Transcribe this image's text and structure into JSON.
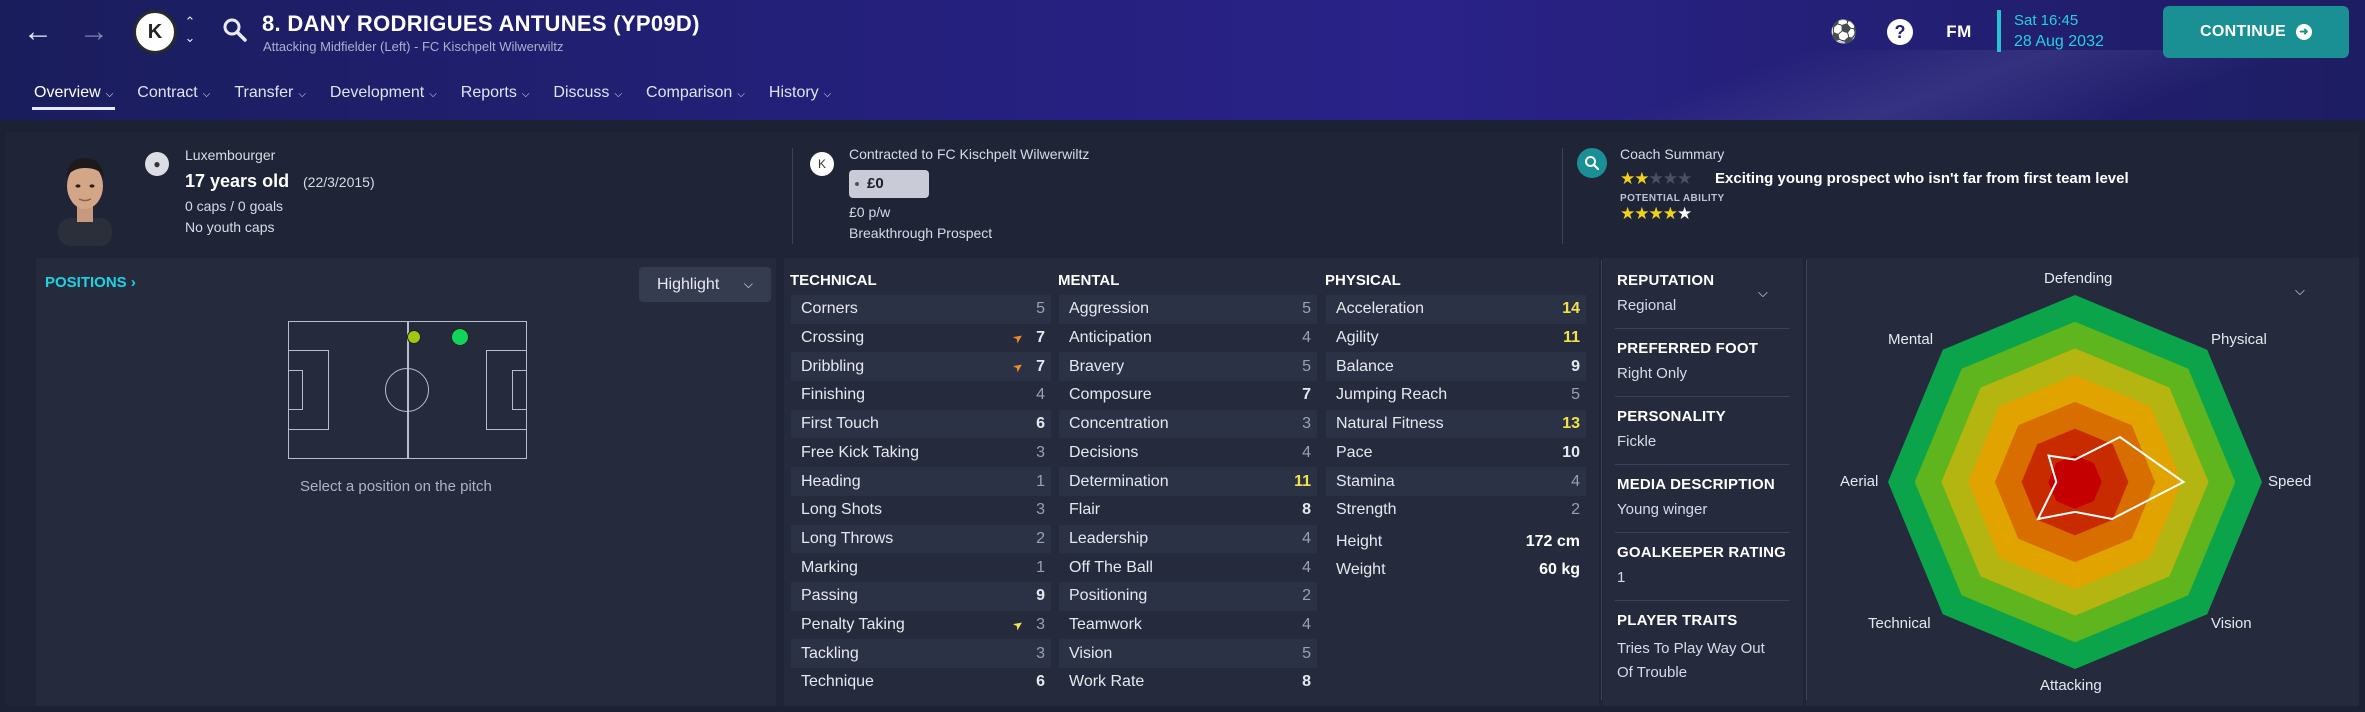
{
  "header": {
    "title": "8. DANY RODRIGUES ANTUNES (YP09D)",
    "subtitle": "Attacking Midfielder (Left) - FC Kischpelt Wilwerwiltz",
    "club_badge_text": "K",
    "fm_logo": "FM",
    "time": "Sat 16:45",
    "date": "28 Aug 2032",
    "continue_label": "CONTINUE",
    "tabs": [
      {
        "label": "Overview"
      },
      {
        "label": "Contract"
      },
      {
        "label": "Transfer"
      },
      {
        "label": "Development"
      },
      {
        "label": "Reports"
      },
      {
        "label": "Discuss"
      },
      {
        "label": "Comparison"
      },
      {
        "label": "History"
      }
    ]
  },
  "profile": {
    "nationality": "Luxembourger",
    "age": "17 years old",
    "dob": "(22/3/2015)",
    "caps": "0 caps / 0 goals",
    "youth_caps": "No youth caps"
  },
  "contract": {
    "contracted_to": "Contracted to FC Kischpelt Wilwerwiltz",
    "value": "£0",
    "wage": "£0 p/w",
    "status": "Breakthrough Prospect"
  },
  "coach": {
    "title": "Coach Summary",
    "summary": "Exciting young prospect who isn't far from first team level",
    "current_ability_stars": 2,
    "potential_label": "POTENTIAL ABILITY",
    "potential_ability_stars": 4.5
  },
  "positions": {
    "title": "POSITIONS",
    "highlight_label": "Highlight",
    "hint": "Select a position on the pitch"
  },
  "technical": {
    "title": "TECHNICAL",
    "attributes": [
      {
        "name": "Corners",
        "value": "5"
      },
      {
        "name": "Crossing",
        "value": "7"
      },
      {
        "name": "Dribbling",
        "value": "7"
      },
      {
        "name": "Finishing",
        "value": "4"
      },
      {
        "name": "First Touch",
        "value": "6"
      },
      {
        "name": "Free Kick Taking",
        "value": "3"
      },
      {
        "name": "Heading",
        "value": "1"
      },
      {
        "name": "Long Shots",
        "value": "3"
      },
      {
        "name": "Long Throws",
        "value": "2"
      },
      {
        "name": "Marking",
        "value": "1"
      },
      {
        "name": "Passing",
        "value": "9"
      },
      {
        "name": "Penalty Taking",
        "value": "3"
      },
      {
        "name": "Tackling",
        "value": "3"
      },
      {
        "name": "Technique",
        "value": "6"
      }
    ]
  },
  "mental": {
    "title": "MENTAL",
    "attributes": [
      {
        "name": "Aggression",
        "value": "5"
      },
      {
        "name": "Anticipation",
        "value": "4"
      },
      {
        "name": "Bravery",
        "value": "5"
      },
      {
        "name": "Composure",
        "value": "7"
      },
      {
        "name": "Concentration",
        "value": "3"
      },
      {
        "name": "Decisions",
        "value": "4"
      },
      {
        "name": "Determination",
        "value": "11"
      },
      {
        "name": "Flair",
        "value": "8"
      },
      {
        "name": "Leadership",
        "value": "4"
      },
      {
        "name": "Off The Ball",
        "value": "4"
      },
      {
        "name": "Positioning",
        "value": "2"
      },
      {
        "name": "Teamwork",
        "value": "4"
      },
      {
        "name": "Vision",
        "value": "5"
      },
      {
        "name": "Work Rate",
        "value": "8"
      }
    ]
  },
  "physical": {
    "title": "PHYSICAL",
    "attributes": [
      {
        "name": "Acceleration",
        "value": "14"
      },
      {
        "name": "Agility",
        "value": "11"
      },
      {
        "name": "Balance",
        "value": "9"
      },
      {
        "name": "Jumping Reach",
        "value": "5"
      },
      {
        "name": "Natural Fitness",
        "value": "13"
      },
      {
        "name": "Pace",
        "value": "10"
      },
      {
        "name": "Stamina",
        "value": "4"
      },
      {
        "name": "Strength",
        "value": "2"
      }
    ],
    "height_label": "Height",
    "height": "172 cm",
    "weight_label": "Weight",
    "weight": "60 kg"
  },
  "info": {
    "reputation_label": "REPUTATION",
    "reputation": "Regional",
    "foot_label": "PREFERRED FOOT",
    "foot": "Right Only",
    "personality_label": "PERSONALITY",
    "personality": "Fickle",
    "media_label": "MEDIA DESCRIPTION",
    "media": "Young winger",
    "gk_label": "GOALKEEPER RATING",
    "gk": "1",
    "traits_label": "PLAYER TRAITS",
    "traits_line1": "Tries To Play Way Out",
    "traits_line2": "Of Trouble"
  },
  "radar": {
    "labels": [
      "Defending",
      "Physical",
      "Speed",
      "Vision",
      "Attacking",
      "Technical",
      "Aerial",
      "Mental"
    ],
    "values_0_to_1": [
      0.12,
      0.34,
      0.58,
      0.28,
      0.16,
      0.28,
      0.1,
      0.2
    ],
    "colors": [
      "#0ca44a",
      "#5fb51d",
      "#b5b512",
      "#e0a300",
      "#d86d00",
      "#c92b00",
      "#c40000"
    ]
  }
}
